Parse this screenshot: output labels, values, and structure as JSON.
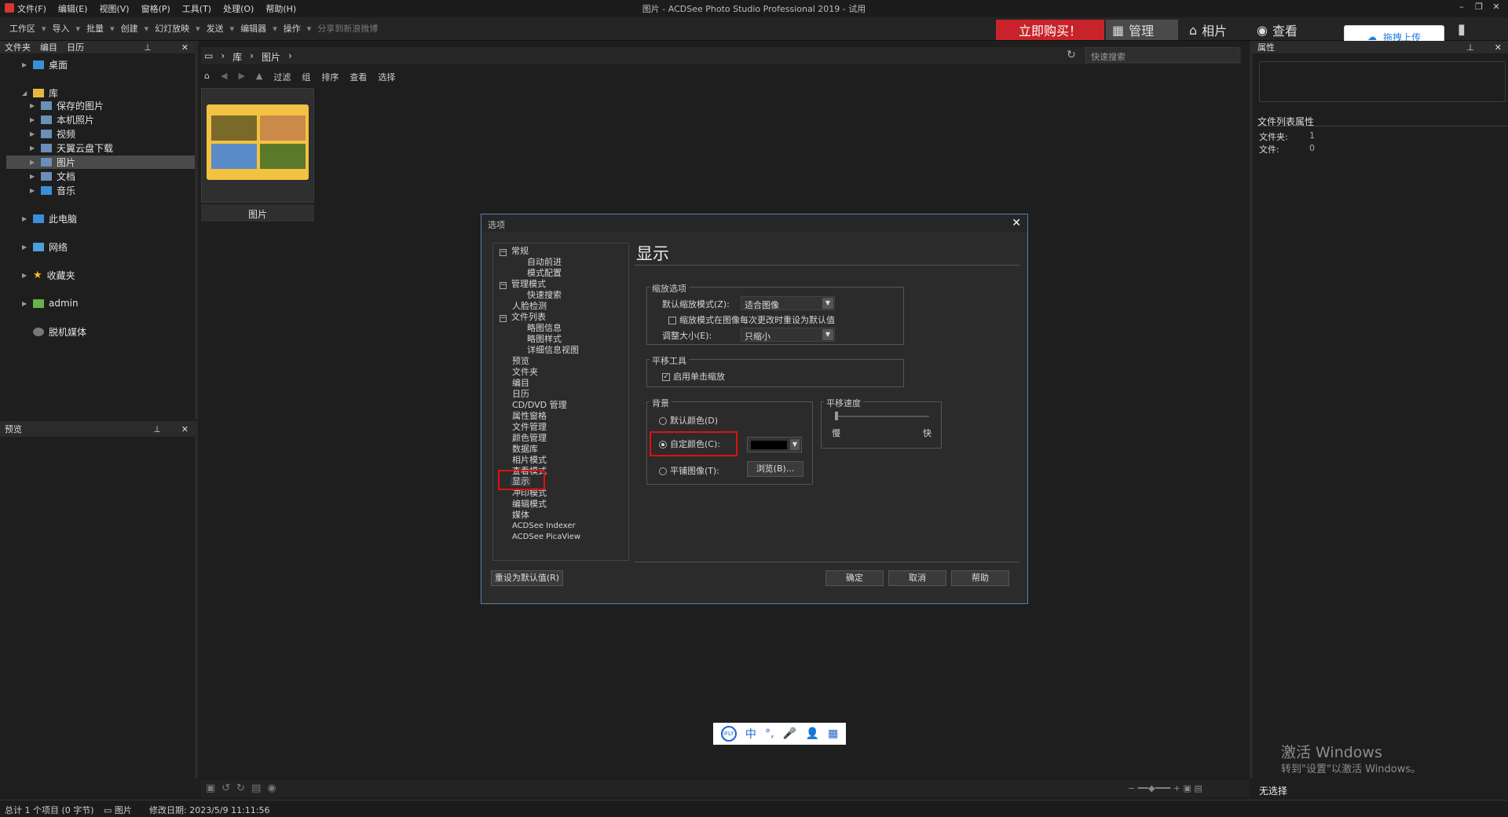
{
  "window": {
    "title": "图片 - ACDSee Photo Studio Professional 2019 - 试用",
    "menu": [
      "文件(F)",
      "编辑(E)",
      "视图(V)",
      "窗格(P)",
      "工具(T)",
      "处理(O)",
      "帮助(H)"
    ]
  },
  "toolbar": {
    "items": [
      "工作区",
      "导入",
      "批量",
      "创建",
      "幻灯放映",
      "发送",
      "编辑器",
      "操作",
      "分享到新浪微博"
    ],
    "buy": "立即购买！",
    "modes": [
      "管理",
      "相片",
      "查看"
    ],
    "upload": "拖拽上传"
  },
  "left_panel": {
    "tabs": [
      "文件夹",
      "编目",
      "日历"
    ],
    "tree": [
      "桌面",
      "库",
      "保存的图片",
      "本机照片",
      "视频",
      "天翼云盘下载",
      "图片",
      "文档",
      "音乐",
      "此电脑",
      "网络",
      "收藏夹",
      "admin",
      "脱机媒体"
    ]
  },
  "preview_panel": {
    "title": "预览"
  },
  "address": {
    "crumbs": [
      "库",
      "图片"
    ],
    "search_placeholder": "快速搜索"
  },
  "filterbar": [
    "过滤",
    "组",
    "排序",
    "查看",
    "选择"
  ],
  "content": {
    "folder_label": "图片"
  },
  "right_panel": {
    "title": "属性",
    "section": "文件列表属性",
    "folders_label": "文件夹:",
    "folders_value": "1",
    "files_label": "文件:",
    "files_value": "0",
    "no_selection": "无选择"
  },
  "status": {
    "total": "总计 1 个项目 (0 字节)",
    "location": "图片",
    "modified": "修改日期: 2023/5/9 11:11:56"
  },
  "dialog": {
    "title": "选项",
    "heading": "显示",
    "nav": [
      "常规",
      "自动前进",
      "模式配置",
      "管理模式",
      "快速搜索",
      "人脸检测",
      "文件列表",
      "略图信息",
      "略图样式",
      "详细信息视图",
      "预览",
      "文件夹",
      "编目",
      "日历",
      "CD/DVD 管理",
      "属性窗格",
      "文件管理",
      "颜色管理",
      "数据库",
      "相片模式",
      "查看模式",
      "显示",
      "冲印模式",
      "编辑模式",
      "媒体",
      "ACDSee Indexer",
      "ACDSee PicaView"
    ],
    "zoom_group": "缩放选项",
    "default_zoom_label": "默认缩放模式(Z):",
    "default_zoom_value": "适合图像",
    "reset_zoom_check": "缩放模式在图像每次更改时重设为默认值",
    "resize_label": "调整大小(E):",
    "resize_value": "只缩小",
    "pan_group": "平移工具",
    "pan_check": "启用单击缩放",
    "bg_group": "背景",
    "bg_default": "默认颜色(D)",
    "bg_custom": "自定颜色(C):",
    "bg_tile": "平铺图像(T):",
    "browse": "浏览(B)...",
    "speed_group": "平移速度",
    "slow": "慢",
    "fast": "快",
    "reset": "重设为默认值(R)",
    "ok": "确定",
    "cancel": "取消",
    "help": "帮助"
  },
  "ime": [
    "中",
    "°,",
    "🎤",
    "👤",
    "▦"
  ],
  "watermark": {
    "line1": "激活 Windows",
    "line2": "转到\"设置\"以激活 Windows。"
  }
}
